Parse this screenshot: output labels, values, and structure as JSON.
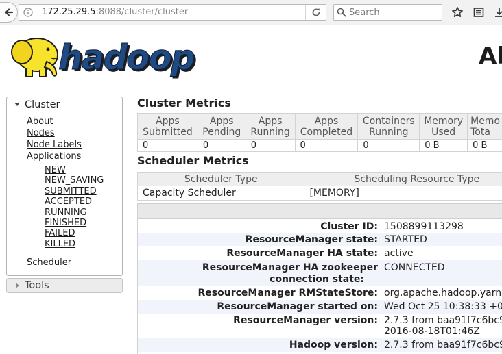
{
  "browser": {
    "url_host": "172.25.29.5",
    "url_path": ":8088/cluster/cluster",
    "search_placeholder": "Search"
  },
  "header": {
    "logo_text": "hadoop",
    "page_title": "Ab"
  },
  "sidebar": {
    "cluster_label": "Cluster",
    "links": [
      {
        "label": "About"
      },
      {
        "label": "Nodes"
      },
      {
        "label": "Node Labels"
      },
      {
        "label": "Applications"
      }
    ],
    "app_states": [
      {
        "label": "NEW"
      },
      {
        "label": "NEW_SAVING"
      },
      {
        "label": "SUBMITTED"
      },
      {
        "label": "ACCEPTED"
      },
      {
        "label": "RUNNING"
      },
      {
        "label": "FINISHED"
      },
      {
        "label": "FAILED"
      },
      {
        "label": "KILLED"
      }
    ],
    "scheduler_label": "Scheduler",
    "tools_label": "Tools"
  },
  "cluster_metrics": {
    "title": "Cluster Metrics",
    "columns": [
      {
        "line1": "Apps",
        "line2": "Submitted"
      },
      {
        "line1": "Apps",
        "line2": "Pending"
      },
      {
        "line1": "Apps",
        "line2": "Running"
      },
      {
        "line1": "Apps",
        "line2": "Completed"
      },
      {
        "line1": "Containers",
        "line2": "Running"
      },
      {
        "line1": "Memory",
        "line2": "Used"
      },
      {
        "line1": "Memo",
        "line2": "Tota"
      }
    ],
    "values": [
      "0",
      "0",
      "0",
      "0",
      "0",
      "0 B",
      "0 B"
    ]
  },
  "scheduler_metrics": {
    "title": "Scheduler Metrics",
    "columns": [
      "Scheduler Type",
      "Scheduling Resource Type"
    ],
    "values": [
      "Capacity Scheduler",
      "[MEMORY]"
    ]
  },
  "cluster_info": [
    {
      "key": "Cluster ID:",
      "value": "1508899113298"
    },
    {
      "key": "ResourceManager state:",
      "value": "STARTED"
    },
    {
      "key": "ResourceManager HA state:",
      "value": "active"
    },
    {
      "key": "ResourceManager HA zookeeper",
      "key2": "connection state:",
      "value": "CONNECTED"
    },
    {
      "key": "ResourceManager RMStateStore:",
      "value": "org.apache.hadoop.yarn."
    },
    {
      "key": "ResourceManager started on:",
      "value": "Wed Oct 25 10:38:33 +0"
    },
    {
      "key": "ResourceManager version:",
      "value": "2.7.3 from baa91f7c6bc9",
      "value2": "2016-08-18T01:46Z"
    },
    {
      "key": "Hadoop version:",
      "value": "2.7.3 from baa91f7c6bc9"
    }
  ]
}
